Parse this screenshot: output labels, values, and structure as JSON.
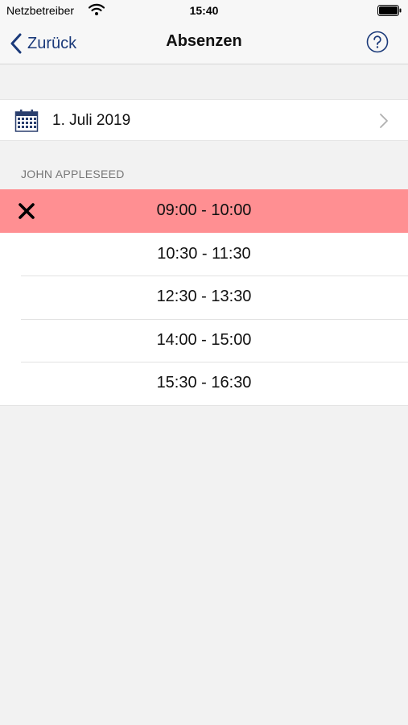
{
  "status_bar": {
    "carrier": "Netzbetreiber",
    "time": "15:40",
    "wifi_icon": "wifi-icon",
    "battery_icon": "battery-icon"
  },
  "nav": {
    "back_label": "Zurück",
    "title": "Absenzen",
    "back_icon": "chevron-left-icon",
    "help_icon": "question-mark-circle-icon",
    "accent_color": "#1b3a7a"
  },
  "date_row": {
    "date": "1. Juli 2019",
    "icon": "calendar-icon",
    "chevron_icon": "chevron-right-icon"
  },
  "section": {
    "header": "JOHN APPLESEED"
  },
  "slots": [
    {
      "time": "09:00 - 10:00",
      "absent": true,
      "status_icon": "x-icon"
    },
    {
      "time": "10:30 - 11:30",
      "absent": false
    },
    {
      "time": "12:30 - 13:30",
      "absent": false
    },
    {
      "time": "14:00 - 15:00",
      "absent": false
    },
    {
      "time": "15:30 - 16:30",
      "absent": false
    }
  ],
  "colors": {
    "absent_row": "#ff8f92",
    "background": "#f2f2f2"
  }
}
